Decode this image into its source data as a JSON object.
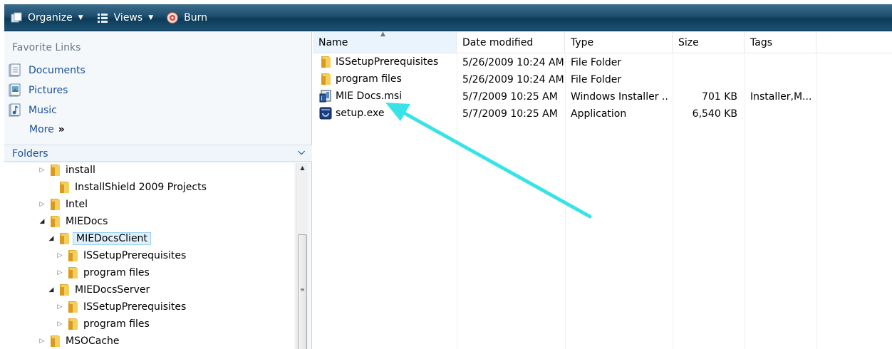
{
  "toolbar": {
    "organize_label": "Organize",
    "views_label": "Views",
    "burn_label": "Burn"
  },
  "favorites": {
    "title": "Favorite Links",
    "items": [
      {
        "label": "Documents",
        "icon": "documents-icon"
      },
      {
        "label": "Pictures",
        "icon": "pictures-icon"
      },
      {
        "label": "Music",
        "icon": "music-icon"
      }
    ],
    "more_label": "More",
    "more_chevron": "»"
  },
  "folders": {
    "title": "Folders",
    "tree": [
      {
        "label": "install",
        "expander": "▷"
      },
      {
        "label": "InstallShield 2009 Projects",
        "expander": ""
      },
      {
        "label": "Intel",
        "expander": "▷"
      },
      {
        "label": "MIEDocs",
        "expander": "◢"
      },
      {
        "label": "MIEDocsClient",
        "expander": "◢",
        "selected": true
      },
      {
        "label": "ISSetupPrerequisites",
        "expander": "▷"
      },
      {
        "label": "program files",
        "expander": "▷"
      },
      {
        "label": "MIEDocsServer",
        "expander": "◢"
      },
      {
        "label": "ISSetupPrerequisites",
        "expander": "▷"
      },
      {
        "label": "program files",
        "expander": "▷"
      },
      {
        "label": "MSOCache",
        "expander": "▷"
      }
    ]
  },
  "file_list": {
    "columns": [
      "Name",
      "Date modified",
      "Type",
      "Size",
      "Tags"
    ],
    "sorted_column": "Name",
    "rows": [
      {
        "name": "ISSetupPrerequisites",
        "date": "5/26/2009 10:24 AM",
        "type": "File Folder",
        "size": "",
        "tags": "",
        "icon": "folder-icon"
      },
      {
        "name": "program files",
        "date": "5/26/2009 10:24 AM",
        "type": "File Folder",
        "size": "",
        "tags": "",
        "icon": "folder-icon"
      },
      {
        "name": "MIE Docs.msi",
        "date": "5/7/2009 10:25 AM",
        "type": "Windows Installer ...",
        "size": "701 KB",
        "tags": "Installer,M...",
        "icon": "msi-installer-icon"
      },
      {
        "name": "setup.exe",
        "date": "5/7/2009 10:25 AM",
        "type": "Application",
        "size": "6,540 KB",
        "tags": "",
        "icon": "setup-exe-icon"
      }
    ]
  },
  "colors": {
    "toolbar_dark": "#0d3a56",
    "link_blue": "#1c4f99",
    "annotation_arrow": "#38e3e8",
    "folder_yellow": "#f2c54b"
  }
}
